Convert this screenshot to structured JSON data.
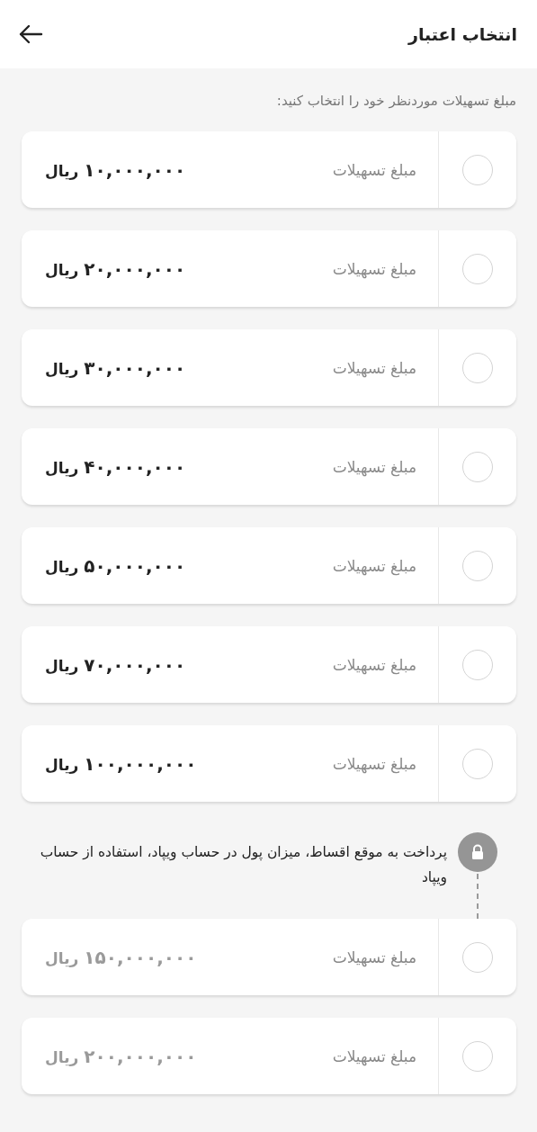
{
  "header": {
    "title": "انتخاب اعتبار"
  },
  "prompt": "مبلغ تسهیلات موردنظر خود را انتخاب کنید:",
  "options": [
    {
      "label": "مبلغ تسهیلات",
      "amount": "۱۰,۰۰۰,۰۰۰",
      "unit": "ریال",
      "selected": false,
      "disabled": false
    },
    {
      "label": "مبلغ تسهیلات",
      "amount": "۲۰,۰۰۰,۰۰۰",
      "unit": "ریال",
      "selected": false,
      "disabled": false
    },
    {
      "label": "مبلغ تسهیلات",
      "amount": "۳۰,۰۰۰,۰۰۰",
      "unit": "ریال",
      "selected": false,
      "disabled": false
    },
    {
      "label": "مبلغ تسهیلات",
      "amount": "۴۰,۰۰۰,۰۰۰",
      "unit": "ریال",
      "selected": false,
      "disabled": false
    },
    {
      "label": "مبلغ تسهیلات",
      "amount": "۵۰,۰۰۰,۰۰۰",
      "unit": "ریال",
      "selected": false,
      "disabled": false
    },
    {
      "label": "مبلغ تسهیلات",
      "amount": "۷۰,۰۰۰,۰۰۰",
      "unit": "ریال",
      "selected": false,
      "disabled": false
    },
    {
      "label": "مبلغ تسهیلات",
      "amount": "۱۰۰,۰۰۰,۰۰۰",
      "unit": "ریال",
      "selected": false,
      "disabled": false
    }
  ],
  "locked_notice": {
    "text": "پرداخت به موقع اقساط، میزان پول در حساب ویپاد، استفاده از حساب ویپاد"
  },
  "locked_options": [
    {
      "label": "مبلغ تسهیلات",
      "amount": "۱۵۰,۰۰۰,۰۰۰",
      "unit": "ریال",
      "selected": false,
      "disabled": true
    },
    {
      "label": "مبلغ تسهیلات",
      "amount": "۲۰۰,۰۰۰,۰۰۰",
      "unit": "ریال",
      "selected": false,
      "disabled": true
    }
  ]
}
